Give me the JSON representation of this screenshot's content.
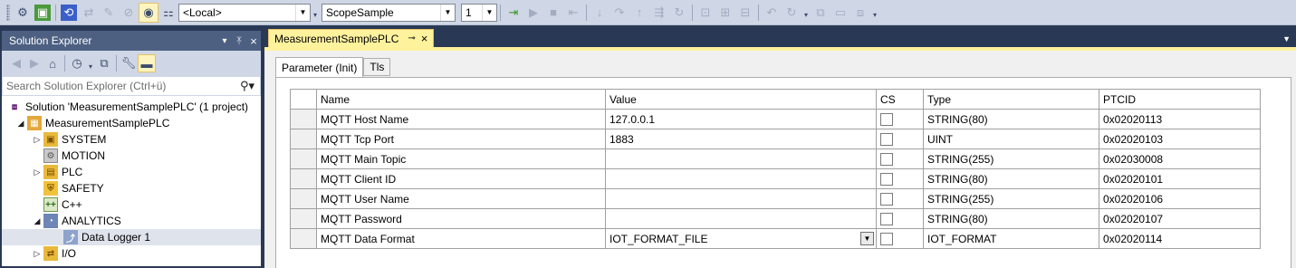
{
  "toolbar": {
    "target_value": "<Local>",
    "project_value": "ScopeSample",
    "number_value": "1",
    "icons": [
      "build-icon",
      "activate-config-icon",
      "restart-icon",
      "tools-icon",
      "disabled-icon",
      "target-browser-icon",
      "config-mode-icon",
      "login-icon",
      "start-icon",
      "stop-icon",
      "logout-icon",
      "step-into-icon",
      "step-over-icon",
      "step-out-icon",
      "run-to-cursor-icon",
      "toggle-breakpoint-icon",
      "bookmark-icon",
      "undo-icon",
      "redo-icon",
      "window-icon"
    ]
  },
  "solution_explorer": {
    "title": "Solution Explorer",
    "search_placeholder": "Search Solution Explorer (Ctrl+ü)",
    "tree": [
      {
        "label": "Solution 'MeasurementSamplePLC' (1 project)",
        "icon": "solution-icon"
      },
      {
        "label": "MeasurementSamplePLC",
        "icon": "project-icon"
      },
      {
        "label": "SYSTEM",
        "icon": "system-icon"
      },
      {
        "label": "MOTION",
        "icon": "motion-icon"
      },
      {
        "label": "PLC",
        "icon": "plc-icon"
      },
      {
        "label": "SAFETY",
        "icon": "safety-icon"
      },
      {
        "label": "C++",
        "icon": "cpp-icon"
      },
      {
        "label": "ANALYTICS",
        "icon": "analytics-icon"
      },
      {
        "label": "Data Logger 1",
        "icon": "data-logger-icon"
      },
      {
        "label": "I/O",
        "icon": "io-icon"
      }
    ]
  },
  "document": {
    "tab_label": "MeasurementSamplePLC",
    "inner_tabs": [
      "Parameter (Init)",
      "Tls"
    ],
    "columns": [
      "Name",
      "Value",
      "CS",
      "Type",
      "PTCID"
    ],
    "rows": [
      {
        "name": "MQTT Host Name",
        "value": "127.0.0.1",
        "type": "STRING(80)",
        "ptcid": "0x02020113"
      },
      {
        "name": "MQTT Tcp Port",
        "value": "1883",
        "type": "UINT",
        "ptcid": "0x02020103"
      },
      {
        "name": "MQTT Main Topic",
        "value": "",
        "type": "STRING(255)",
        "ptcid": "0x02030008"
      },
      {
        "name": "MQTT Client ID",
        "value": "",
        "type": "STRING(80)",
        "ptcid": "0x02020101"
      },
      {
        "name": "MQTT User Name",
        "value": "",
        "type": "STRING(255)",
        "ptcid": "0x02020106"
      },
      {
        "name": "MQTT Password",
        "value": "",
        "type": "STRING(80)",
        "ptcid": "0x02020107"
      },
      {
        "name": "MQTT Data Format",
        "value": "IOT_FORMAT_FILE",
        "type": "IOT_FORMAT",
        "ptcid": "0x02020114"
      }
    ]
  }
}
